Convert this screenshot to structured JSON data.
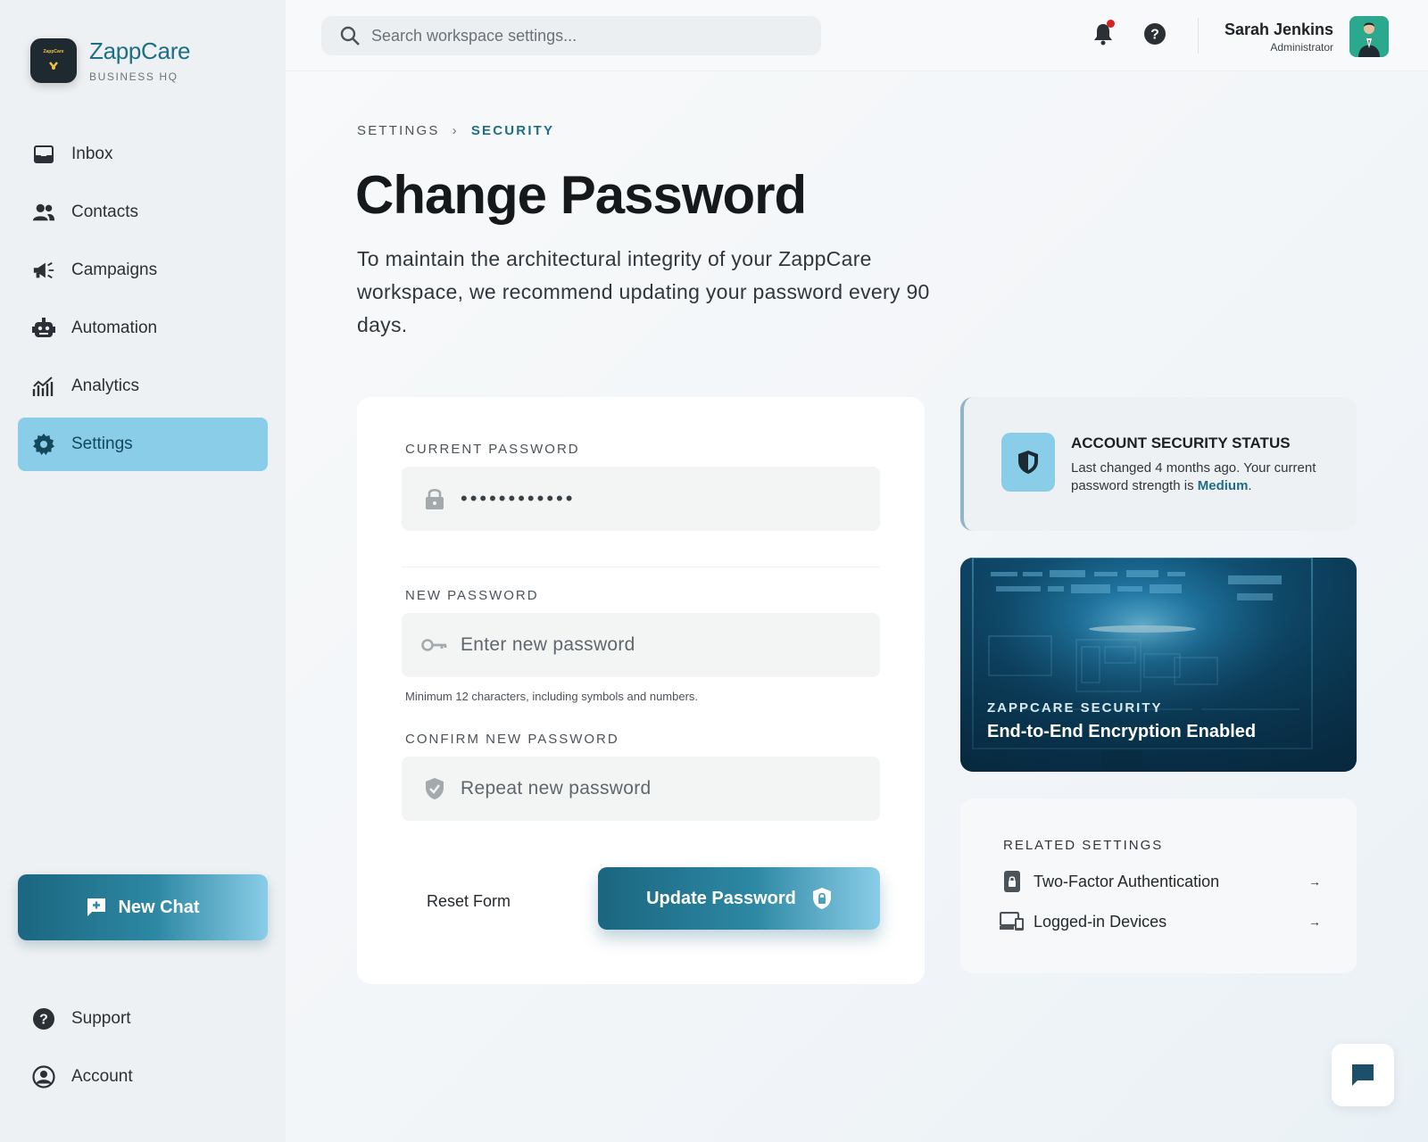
{
  "brand": {
    "name": "ZappCare",
    "subtitle": "BUSINESS HQ",
    "logo_text": "ZappCare"
  },
  "sidebar": {
    "items": [
      {
        "label": "Inbox",
        "icon": "inbox-icon"
      },
      {
        "label": "Contacts",
        "icon": "contacts-icon"
      },
      {
        "label": "Campaigns",
        "icon": "megaphone-icon"
      },
      {
        "label": "Automation",
        "icon": "robot-icon"
      },
      {
        "label": "Analytics",
        "icon": "analytics-icon"
      },
      {
        "label": "Settings",
        "icon": "gear-icon",
        "active": true
      }
    ],
    "new_chat_label": "New Chat",
    "bottom_items": [
      {
        "label": "Support",
        "icon": "help-circle-icon"
      },
      {
        "label": "Account",
        "icon": "account-circle-icon"
      }
    ]
  },
  "topbar": {
    "search_placeholder": "Search workspace settings...",
    "user_name": "Sarah Jenkins",
    "user_role": "Administrator",
    "has_notification": true
  },
  "main": {
    "breadcrumb": {
      "parent": "SETTINGS",
      "separator": "›",
      "current": "SECURITY"
    },
    "title": "Change Password",
    "description": "To maintain the architectural integrity of your ZappCare workspace, we recommend updating your password every 90 days.",
    "form": {
      "current_label": "CURRENT PASSWORD",
      "current_value": "••••••••••••",
      "new_label": "NEW PASSWORD",
      "new_placeholder": "Enter new password",
      "hint": "Minimum 12 characters, including symbols and numbers.",
      "confirm_label": "CONFIRM NEW PASSWORD",
      "confirm_placeholder": "Repeat new password",
      "reset_label": "Reset Form",
      "submit_label": "Update Password"
    },
    "status": {
      "title": "ACCOUNT SECURITY STATUS",
      "text_before": "Last changed 4 months ago. Your current password strength is ",
      "strength": "Medium",
      "text_after": "."
    },
    "promo": {
      "label": "ZAPPCARE SECURITY",
      "title": "End-to-End Encryption Enabled"
    },
    "related": {
      "title": "RELATED SETTINGS",
      "items": [
        {
          "label": "Two-Factor Authentication",
          "icon": "phone-lock-icon"
        },
        {
          "label": "Logged-in Devices",
          "icon": "devices-icon"
        }
      ],
      "arrow": "→"
    }
  },
  "colors": {
    "accent": "#1d6e86",
    "active_nav": "#8acde8",
    "gradient_start": "#1b6680",
    "gradient_end": "#8acde8",
    "notification": "#d32222"
  }
}
